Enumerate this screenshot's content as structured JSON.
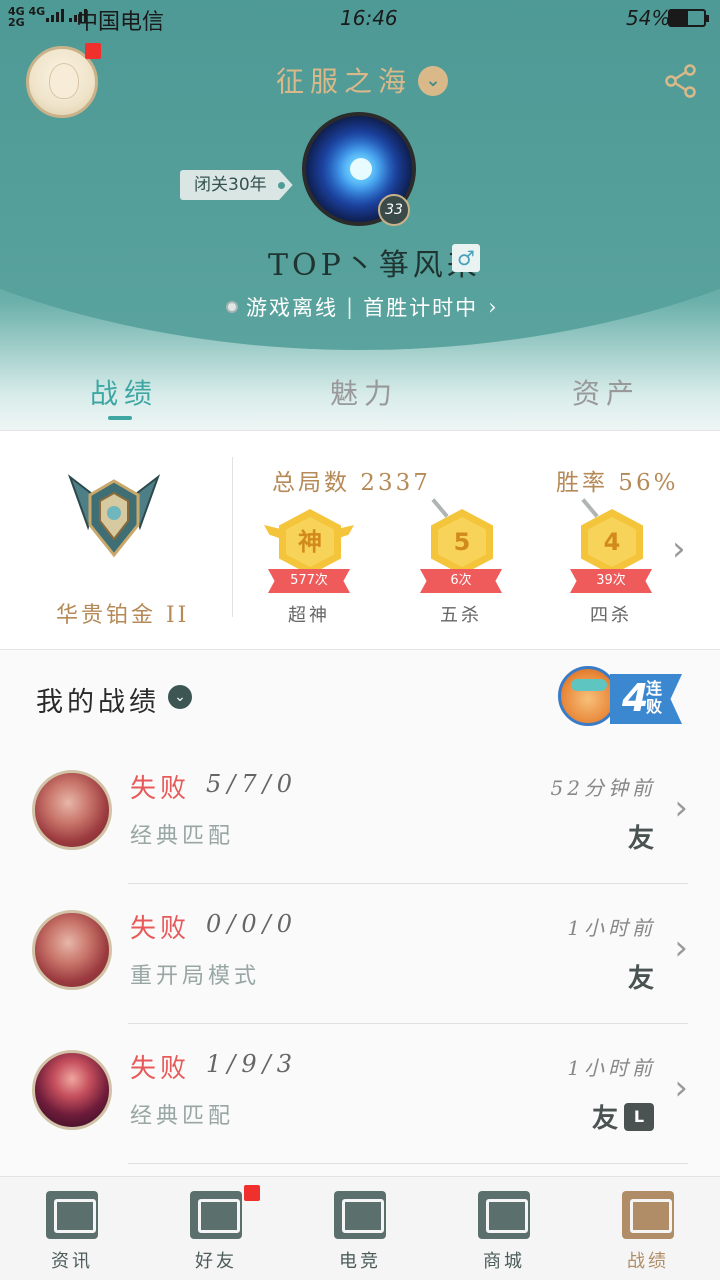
{
  "status_bar": {
    "signal_text": "4G 4G\n2G",
    "carrier": "中国电信",
    "time": "16:46",
    "battery_pct": "54%",
    "battery_level": 0.54
  },
  "header": {
    "server": "征服之海",
    "tag": "闭关30年",
    "level": "33",
    "username": "TOP丶箏风来",
    "gender_symbol": "♂",
    "online_status": "游戏离线",
    "first_win": "首胜计时中",
    "online_chevron": "›",
    "server_chevron": "⌄"
  },
  "tabs": [
    {
      "label": "战绩",
      "active": true
    },
    {
      "label": "魅力",
      "active": false
    },
    {
      "label": "资产",
      "active": false
    }
  ],
  "stats": {
    "rank_name": "华贵铂金 II",
    "total_games": "总局数 2337",
    "win_rate": "胜率 56%",
    "medals": [
      {
        "glyph": "神",
        "count": "577次",
        "label": "超神",
        "icon": "godlike-medal-icon"
      },
      {
        "glyph": "5",
        "count": "6次",
        "label": "五杀",
        "icon": "penta-kill-medal-icon"
      },
      {
        "glyph": "4",
        "count": "39次",
        "label": "四杀",
        "icon": "quadra-kill-medal-icon"
      }
    ],
    "chevron": "›"
  },
  "records": {
    "title": "我的战绩",
    "title_chevron": "⌄",
    "streak": {
      "number": "4",
      "text": "连败"
    },
    "rows": [
      {
        "result": "失败",
        "kda": "5/7/0",
        "mode": "经典匹配",
        "ago": "52分钟前",
        "badge": "友",
        "badge2": ""
      },
      {
        "result": "失败",
        "kda": "0/0/0",
        "mode": "重开局模式",
        "ago": "1小时前",
        "badge": "友",
        "badge2": ""
      },
      {
        "result": "失败",
        "kda": "1/9/3",
        "mode": "经典匹配",
        "ago": "1小时前",
        "badge": "友",
        "badge2": "L"
      }
    ]
  },
  "nav": [
    {
      "label": "资讯",
      "icon": "news-icon",
      "active": false,
      "dot": false
    },
    {
      "label": "好友",
      "icon": "friends-icon",
      "active": false,
      "dot": true
    },
    {
      "label": "电竞",
      "icon": "esports-icon",
      "active": false,
      "dot": false
    },
    {
      "label": "商城",
      "icon": "store-icon",
      "active": false,
      "dot": false
    },
    {
      "label": "战绩",
      "icon": "record-icon",
      "active": true,
      "dot": false
    }
  ],
  "colors": {
    "header_teal": "#3d8d8a",
    "accent_teal": "#3ea7a3",
    "gold_text": "#b58a57",
    "loss_red": "#e85a5a",
    "badge_red": "#f0302c"
  }
}
